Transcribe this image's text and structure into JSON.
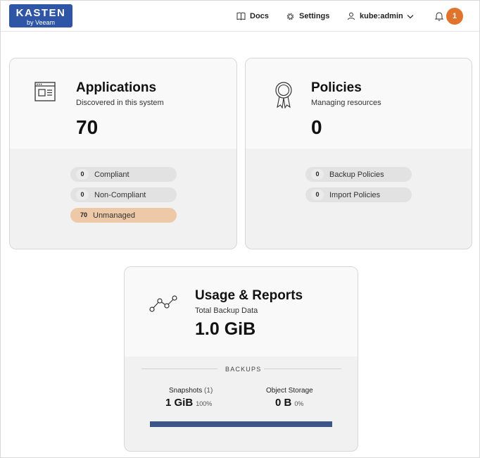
{
  "header": {
    "logo_main": "KASTEN",
    "logo_sub": "by Veeam",
    "docs_label": "Docs",
    "settings_label": "Settings",
    "user_label": "kube:admin",
    "notification_count": "1",
    "icons": [
      "book-icon",
      "gear-icon",
      "user-icon",
      "chevron-down-icon",
      "bell-icon"
    ]
  },
  "applications": {
    "title": "Applications",
    "subtitle": "Discovered in this system",
    "count": "70",
    "icon": "window-icon",
    "pills": [
      {
        "count": "0",
        "label": "Compliant"
      },
      {
        "count": "0",
        "label": "Non-Compliant"
      },
      {
        "count": "70",
        "label": "Unmanaged",
        "color": "#edc9a8"
      }
    ]
  },
  "policies": {
    "title": "Policies",
    "subtitle": "Managing resources",
    "count": "0",
    "icon": "award-ribbon-icon",
    "pills": [
      {
        "count": "0",
        "label": "Backup Policies"
      },
      {
        "count": "0",
        "label": "Import Policies"
      }
    ]
  },
  "usage": {
    "title": "Usage & Reports",
    "subtitle": "Total Backup Data",
    "total": "1.0 GiB",
    "icon": "line-graph-icon",
    "section_label": "BACKUPS",
    "snapshots_label": "Snapshots",
    "snapshots_count": "(1)",
    "snapshots_value": "1 GiB",
    "snapshots_pct": "100%",
    "object_label": "Object Storage",
    "object_value": "0 B",
    "object_pct": "0%",
    "bar_fill_fraction": 1.0,
    "bar_color": "#3c5587"
  },
  "colors": {
    "brand": "#2f56a6",
    "notification": "#e0742c",
    "unmanaged": "#edc9a8"
  }
}
